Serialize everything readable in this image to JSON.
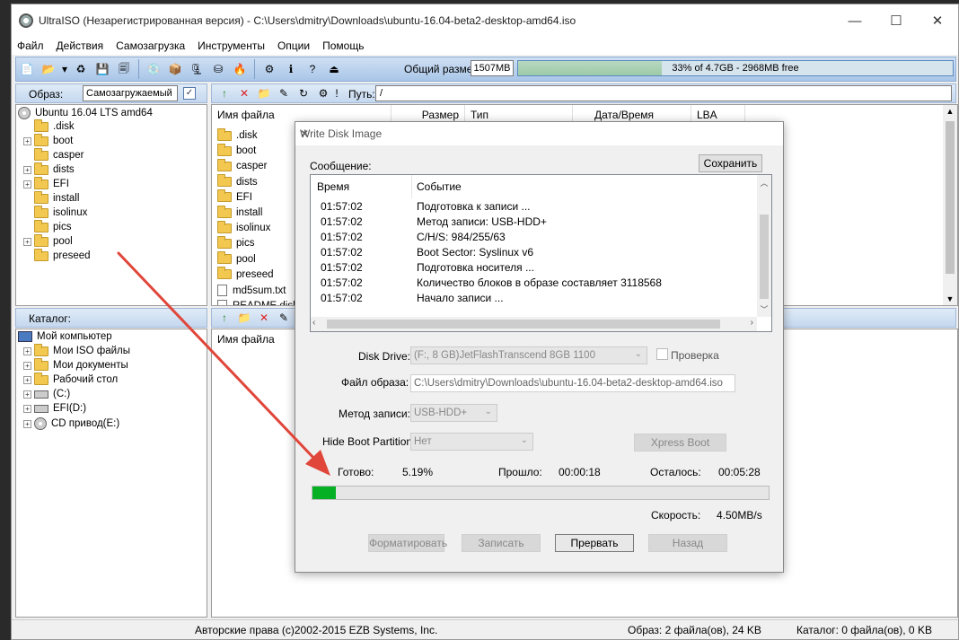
{
  "window": {
    "title": "UltraISO (Незарегистрированная версия) - C:\\Users\\dmitry\\Downloads\\ubuntu-16.04-beta2-desktop-amd64.iso",
    "minimize": "—",
    "maximize": "☐",
    "close": "✕"
  },
  "menu": [
    "Файл",
    "Действия",
    "Самозагрузка",
    "Инструменты",
    "Опции",
    "Помощь"
  ],
  "toolbar": {
    "size_label": "Общий размер:",
    "size_value": "1507MB",
    "size_bar_text": "33% of 4.7GB - 2968MB free",
    "size_fraction": 0.33,
    "icons": [
      "new-icon",
      "open-icon",
      "dropdown-icon",
      "burn-icon",
      "save-icon",
      "save-as-icon",
      "make-cd-image-icon",
      "extract-icon",
      "compress-icon",
      "mount-icon",
      "burn-cd-icon",
      "options-icon",
      "info-icon",
      "help-icon",
      "exit-icon"
    ]
  },
  "image_panel": {
    "label": "Образ:",
    "value": "Самозагружаемый"
  },
  "path_panel": {
    "label": "Путь:",
    "value": "/"
  },
  "iso_tree": {
    "root": "Ubuntu 16.04 LTS amd64",
    "items": [
      {
        "name": ".disk",
        "expandable": false
      },
      {
        "name": "boot",
        "expandable": true
      },
      {
        "name": "casper",
        "expandable": false
      },
      {
        "name": "dists",
        "expandable": true
      },
      {
        "name": "EFI",
        "expandable": true
      },
      {
        "name": "install",
        "expandable": false
      },
      {
        "name": "isolinux",
        "expandable": false
      },
      {
        "name": "pics",
        "expandable": false
      },
      {
        "name": "pool",
        "expandable": true
      },
      {
        "name": "preseed",
        "expandable": false
      }
    ]
  },
  "file_list": {
    "columns": [
      "Имя файла",
      "Размер",
      "Тип",
      "Дата/Время",
      "LBA"
    ],
    "items": [
      {
        "name": ".disk",
        "type": "folder"
      },
      {
        "name": "boot",
        "type": "folder"
      },
      {
        "name": "casper",
        "type": "folder"
      },
      {
        "name": "dists",
        "type": "folder"
      },
      {
        "name": "EFI",
        "type": "folder"
      },
      {
        "name": "install",
        "type": "folder"
      },
      {
        "name": "isolinux",
        "type": "folder"
      },
      {
        "name": "pics",
        "type": "folder"
      },
      {
        "name": "pool",
        "type": "folder"
      },
      {
        "name": "preseed",
        "type": "folder"
      },
      {
        "name": "md5sum.txt",
        "type": "file"
      },
      {
        "name": "README.diskdefines",
        "type": "file"
      }
    ]
  },
  "catalog_panel": {
    "label": "Каталог:"
  },
  "local_tree": {
    "root": "Мой компьютер",
    "items": [
      {
        "name": "Мои ISO файлы",
        "icon": "folder"
      },
      {
        "name": "Мои документы",
        "icon": "folder"
      },
      {
        "name": "Рабочий стол",
        "icon": "folder"
      },
      {
        "name": "(C:)",
        "icon": "drive"
      },
      {
        "name": "EFI(D:)",
        "icon": "drive"
      },
      {
        "name": "CD привод(E:)",
        "icon": "disc"
      }
    ]
  },
  "local_list": {
    "columns": [
      "Имя файла"
    ]
  },
  "status": {
    "copyright": "Авторские права (c)2002-2015 EZB Systems, Inc.",
    "image_info": "Образ: 2 файла(ов), 24 KB",
    "catalog_info": "Каталог: 0 файла(ов), 0 KB"
  },
  "dialog": {
    "title": "Write Disk Image",
    "close": "✕",
    "message_label": "Сообщение:",
    "save_button": "Сохранить",
    "log_columns": [
      "Время",
      "Событие"
    ],
    "log": [
      {
        "time": "01:57:02",
        "event": "Подготовка к записи ..."
      },
      {
        "time": "01:57:02",
        "event": "Метод записи: USB-HDD+"
      },
      {
        "time": "01:57:02",
        "event": "C/H/S: 984/255/63"
      },
      {
        "time": "01:57:02",
        "event": "Boot Sector: Syslinux v6"
      },
      {
        "time": "01:57:02",
        "event": "Подготовка носителя ..."
      },
      {
        "time": "01:57:02",
        "event": "Количество блоков в образе составляет 3118568"
      },
      {
        "time": "01:57:02",
        "event": "Начало записи ..."
      }
    ],
    "disk_drive_label": "Disk Drive:",
    "disk_drive_value": "(F:, 8 GB)JetFlashTranscend 8GB   1100",
    "verify_label": "Проверка",
    "image_file_label": "Файл образа:",
    "image_file_value": "C:\\Users\\dmitry\\Downloads\\ubuntu-16.04-beta2-desktop-amd64.iso",
    "write_method_label": "Метод записи:",
    "write_method_value": "USB-HDD+",
    "hide_boot_label": "Hide Boot Partition:",
    "hide_boot_value": "Нет",
    "xpress_boot_button": "Xpress Boot",
    "done_label": "Готово:",
    "done_value": "5.19%",
    "progress_fraction": 0.0519,
    "elapsed_label": "Прошло:",
    "elapsed_value": "00:00:18",
    "remaining_label": "Осталось:",
    "remaining_value": "00:05:28",
    "speed_label": "Скорость:",
    "speed_value": "4.50MB/s",
    "buttons": {
      "format": "Форматировать",
      "write": "Записать",
      "abort": "Прервать",
      "back": "Назад"
    }
  },
  "colors": {
    "progress": "#06b025",
    "annotation_arrow": "#e0463a",
    "toolbar": "#a9c6e8"
  }
}
